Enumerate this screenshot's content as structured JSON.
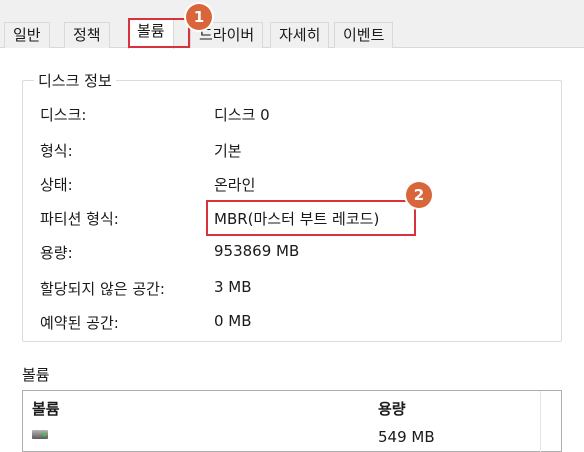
{
  "tabs": [
    "일반",
    "정책",
    "볼륨",
    "드라이버",
    "자세히",
    "이벤트"
  ],
  "active_tab": "볼륨",
  "callouts": [
    "1",
    "2"
  ],
  "disk_info": {
    "title": "디스크 정보",
    "rows": [
      {
        "label": "디스크:",
        "value": "디스크 0"
      },
      {
        "label": "형식:",
        "value": "기본"
      },
      {
        "label": "상태:",
        "value": "온라인"
      },
      {
        "label": "파티션 형식:",
        "value": "MBR(마스터 부트 레코드)"
      },
      {
        "label": "용량:",
        "value": "953869 MB"
      },
      {
        "label": "할당되지 않은 공간:",
        "value": "3 MB"
      },
      {
        "label": "예약된 공간:",
        "value": "0 MB"
      }
    ]
  },
  "volumes": {
    "title": "볼륨",
    "columns": [
      "볼륨",
      "용량"
    ],
    "rows": [
      {
        "icon": "drive-icon",
        "name": "",
        "capacity": "549 MB"
      }
    ]
  },
  "colors": {
    "highlight": "#d9323c",
    "badge": "#d9663a"
  }
}
